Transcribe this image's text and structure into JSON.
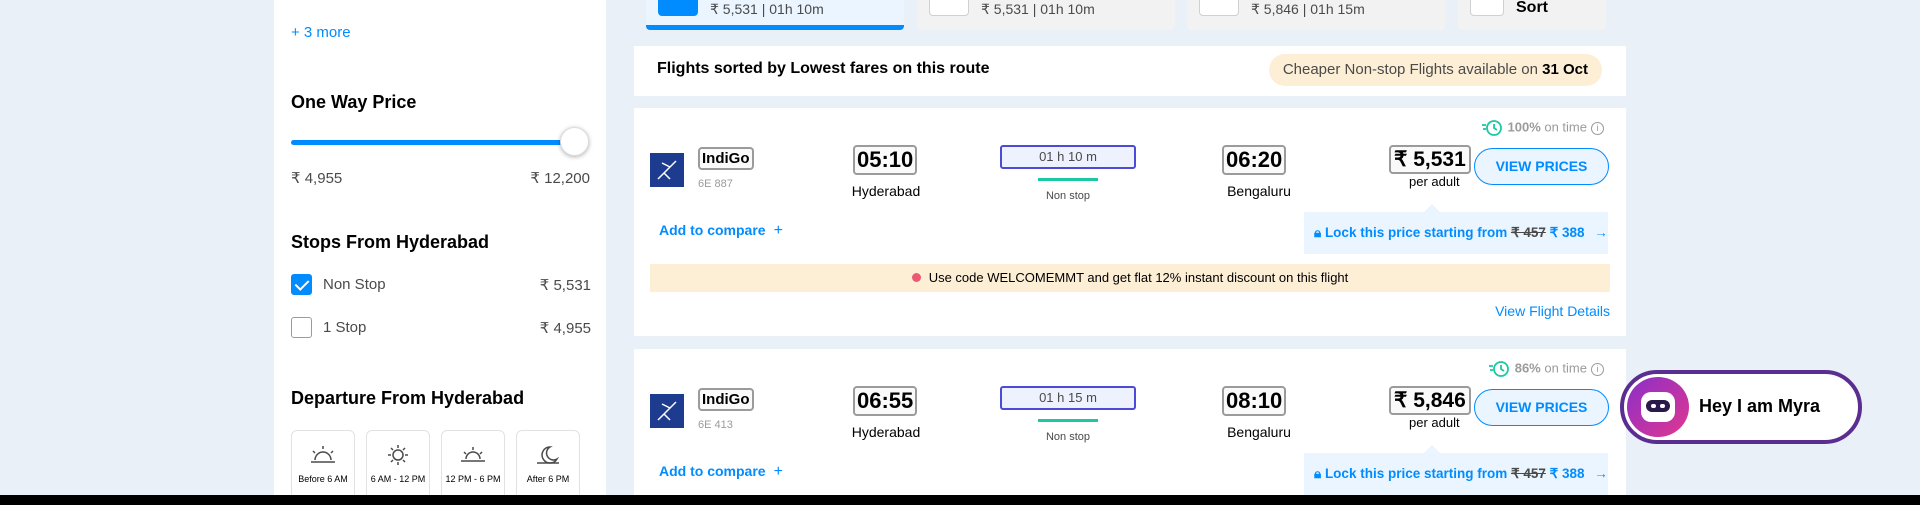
{
  "sidebar": {
    "more_link": "+ 3 more",
    "price_heading": "One Way Price",
    "price_min": "₹ 4,955",
    "price_max": "₹ 12,200",
    "stops_heading": "Stops From Hyderabad",
    "stops": [
      {
        "label": "Non Stop",
        "price": "₹ 5,531",
        "checked": true
      },
      {
        "label": "1 Stop",
        "price": "₹ 4,955",
        "checked": false
      }
    ],
    "departure_heading": "Departure From Hyderabad",
    "departure_slots": [
      "Before 6 AM",
      "6 AM - 12 PM",
      "12 PM - 6 PM",
      "After 6 PM"
    ]
  },
  "sort_tabs": [
    {
      "text": "₹ 5,531 | 01h 10m",
      "active": true
    },
    {
      "text": "₹ 5,531 | 01h 10m",
      "active": false
    },
    {
      "text": "₹ 5,846 | 01h 15m",
      "active": false
    },
    {
      "text": "Sort",
      "active": false
    }
  ],
  "info_bar": {
    "title": "Flights sorted by Lowest fares on this route",
    "pill_prefix": "Cheaper Non-stop Flights available on ",
    "pill_date": "31 Oct"
  },
  "flights": [
    {
      "ontime_pct": "100%",
      "ontime_suffix": " on time",
      "airline": "IndiGo",
      "flight_no": "6E 887",
      "dep_time": "05:10",
      "dep_city": "Hyderabad",
      "duration": "01 h 10 m",
      "stops": "Non stop",
      "arr_time": "06:20",
      "arr_city": "Bengaluru",
      "price": "₹ 5,531",
      "per_adult": "per adult",
      "view_prices": "VIEW PRICES",
      "compare": "Add to compare",
      "lock_text": "Lock this price starting from ",
      "lock_old": "₹ 457",
      "lock_new": " ₹ 388",
      "lock_arrow": "→",
      "promo": "Use code WELCOMEMMT and get flat 12% instant discount on this flight",
      "details": "View Flight Details"
    },
    {
      "ontime_pct": "86%",
      "ontime_suffix": " on time",
      "airline": "IndiGo",
      "flight_no": "6E 413",
      "dep_time": "06:55",
      "dep_city": "Hyderabad",
      "duration": "01 h 15 m",
      "stops": "Non stop",
      "arr_time": "08:10",
      "arr_city": "Bengaluru",
      "price": "₹ 5,846",
      "per_adult": "per adult",
      "view_prices": "VIEW PRICES",
      "compare": "Add to compare",
      "lock_text": "Lock this price starting from ",
      "lock_old": "₹ 457",
      "lock_new": " ₹ 388",
      "lock_arrow": "→"
    }
  ],
  "myra": {
    "label": "Hey I am Myra"
  },
  "colors": {
    "accent": "#008cff",
    "promo_bg": "#fdefd6",
    "ontime_green": "#1cc8a4"
  }
}
